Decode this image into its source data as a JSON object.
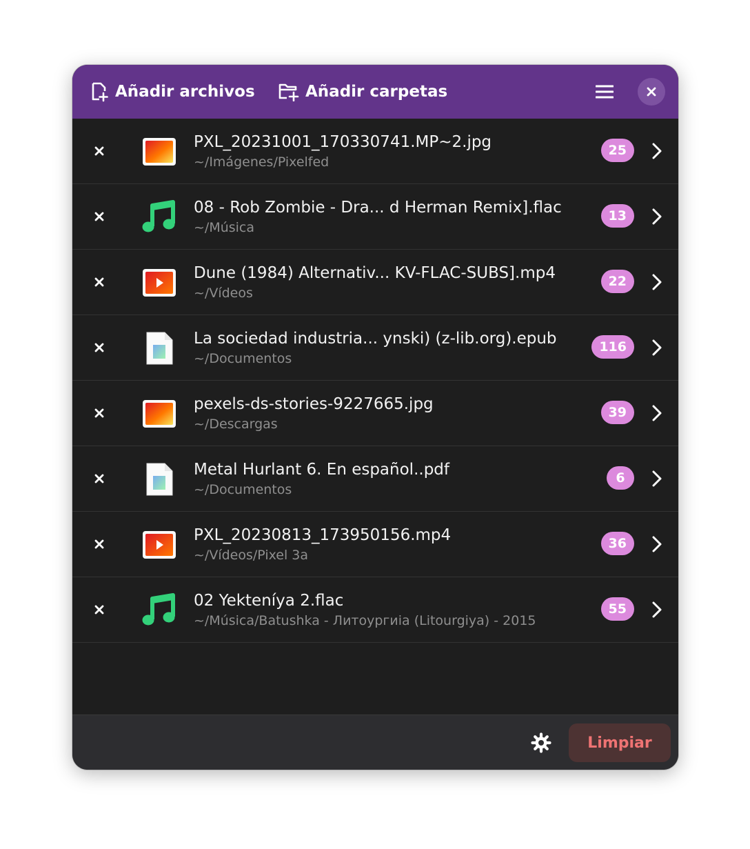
{
  "header": {
    "add_files_label": "Añadir archivos",
    "add_folders_label": "Añadir carpetas"
  },
  "files": [
    {
      "name": "PXL_20231001_170330741.MP~2.jpg",
      "path": "~/Imágenes/Pixelfed",
      "count": "25",
      "type": "image-icon"
    },
    {
      "name": "08 - Rob Zombie - Dra...  d Herman Remix].flac",
      "path": "~/Música",
      "count": "13",
      "type": "music-icon"
    },
    {
      "name": "Dune (1984) Alternativ...  KV-FLAC-SUBS].mp4",
      "path": "~/Vídeos",
      "count": "22",
      "type": "video-icon"
    },
    {
      "name": "La sociedad industria... ynski) (z-lib.org).epub",
      "path": "~/Documentos",
      "count": "116",
      "type": "document-icon"
    },
    {
      "name": "pexels-ds-stories-9227665.jpg",
      "path": "~/Descargas",
      "count": "39",
      "type": "image-icon"
    },
    {
      "name": "Metal Hurlant 6. En español..pdf",
      "path": "~/Documentos",
      "count": "6",
      "type": "document-icon"
    },
    {
      "name": "PXL_20230813_173950156.mp4",
      "path": "~/Vídeos/Pixel 3a",
      "count": "36",
      "type": "video-icon"
    },
    {
      "name": "02 Yekteníya 2.flac",
      "path": "~/Música/Batushka - Литоургиiа (Litourgiya) - 2015",
      "count": "55",
      "type": "music-icon"
    }
  ],
  "footer": {
    "clear_label": "Limpiar"
  },
  "colors": {
    "header_bg": "#62348a",
    "badge_bg": "#dc8add",
    "music_green": "#33d17a",
    "clear_text": "#ef7373",
    "clear_bg": "#4d3333"
  }
}
